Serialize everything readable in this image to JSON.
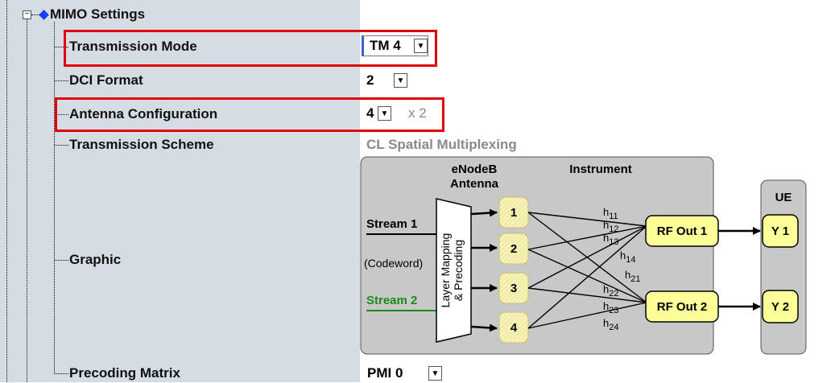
{
  "tree": {
    "section_title": "MIMO Settings",
    "rows": {
      "transmission_mode": {
        "label": "Transmission Mode",
        "value": "TM 4"
      },
      "dci_format": {
        "label": "DCI Format",
        "value": "2"
      },
      "antenna_configuration": {
        "label": "Antenna Configuration",
        "value": "4",
        "suffix": "x 2"
      },
      "transmission_scheme": {
        "label": "Transmission Scheme",
        "value": "CL Spatial Multiplexing"
      },
      "graphic": {
        "label": "Graphic"
      },
      "precoding_matrix": {
        "label": "Precoding Matrix",
        "value": "PMI 0"
      }
    }
  },
  "graphic": {
    "header_enodeb_line1": "eNodeB",
    "header_enodeb_line2": "Antenna",
    "header_instrument": "Instrument",
    "header_ue": "UE",
    "stream1": "Stream 1",
    "codeword": "(Codeword)",
    "stream2": "Stream 2",
    "mapping_line1": "Layer Mapping",
    "mapping_line2": "& Precoding",
    "antennas": [
      "1",
      "2",
      "3",
      "4"
    ],
    "rf_out1": "RF Out 1",
    "rf_out2": "RF Out 2",
    "ue1": "Y 1",
    "ue2": "Y 2",
    "h_labels": [
      "h11",
      "h12",
      "h13",
      "h14",
      "h21",
      "h22",
      "h23",
      "h24"
    ]
  },
  "colors": {
    "highlight_border": "#e00000",
    "stream2_green": "#1a8a1a",
    "antenna_fill": "#f5f0b0",
    "rf_fill": "#ffff99",
    "panel_bg": "#c8c8c8",
    "tree_bg": "#d6dce3"
  },
  "icons": {
    "expander": "minus-expander-icon",
    "section": "blue-diamond-icon",
    "dropdown": "triangle-down-icon"
  }
}
